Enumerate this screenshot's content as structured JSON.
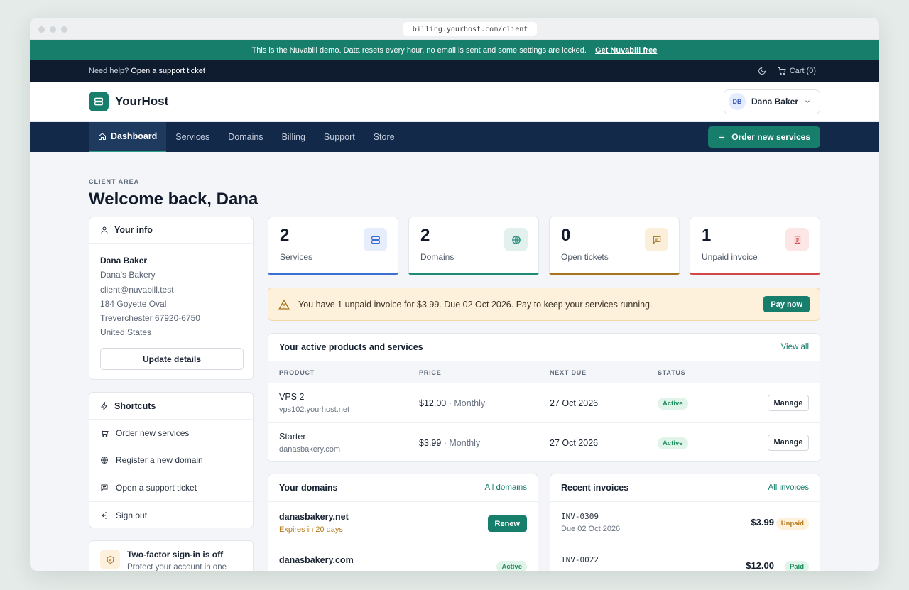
{
  "browser": {
    "url": "billing.yourhost.com/client"
  },
  "demo_banner": {
    "text": "This is the Nuvabill demo. Data resets every hour, no email is sent and some settings are locked.",
    "link": "Get Nuvabill free"
  },
  "topbar": {
    "help_prefix": "Need help?",
    "help_link": "Open a support ticket",
    "cart": "Cart (0)"
  },
  "header": {
    "brand": "YourHost",
    "user_initials": "DB",
    "user_name": "Dana Baker"
  },
  "nav": {
    "items": [
      {
        "label": "Dashboard",
        "active": true
      },
      {
        "label": "Services"
      },
      {
        "label": "Domains"
      },
      {
        "label": "Billing"
      },
      {
        "label": "Support"
      },
      {
        "label": "Store"
      }
    ],
    "order_button": "Order new services"
  },
  "page": {
    "eyebrow": "CLIENT AREA",
    "title": "Welcome back, Dana"
  },
  "your_info": {
    "title": "Your info",
    "name": "Dana Baker",
    "company": "Dana's Bakery",
    "email": "client@nuvabill.test",
    "address1": "184 Goyette Oval",
    "address2": "Treverchester 67920-6750",
    "country": "United States",
    "button": "Update details"
  },
  "shortcuts": {
    "title": "Shortcuts",
    "items": [
      "Order new services",
      "Register a new domain",
      "Open a support ticket",
      "Sign out"
    ]
  },
  "twofa": {
    "title": "Two-factor sign-in is off",
    "subtitle": "Protect your account in one"
  },
  "stats": [
    {
      "value": "2",
      "label": "Services",
      "color": "#3b6fd1",
      "bg": "#e6edfb"
    },
    {
      "value": "2",
      "label": "Domains",
      "color": "#1f8a76",
      "bg": "#e2f1ee"
    },
    {
      "value": "0",
      "label": "Open tickets",
      "color": "#a6741c",
      "bg": "#fbefd9"
    },
    {
      "value": "1",
      "label": "Unpaid invoice",
      "color": "#d24848",
      "bg": "#fde6e6"
    }
  ],
  "alert": {
    "text": "You have 1 unpaid invoice for $3.99. Due 02 Oct 2026. Pay to keep your services running.",
    "button": "Pay now"
  },
  "services": {
    "title": "Your active products and services",
    "link": "View all",
    "columns": [
      "PRODUCT",
      "PRICE",
      "NEXT DUE",
      "STATUS"
    ],
    "rows": [
      {
        "name": "VPS 2",
        "host": "vps102.yourhost.net",
        "price": "$12.00",
        "cycle": "· Monthly",
        "due": "27 Oct 2026",
        "status": "Active",
        "action": "Manage"
      },
      {
        "name": "Starter",
        "host": "danasbakery.com",
        "price": "$3.99",
        "cycle": "· Monthly",
        "due": "27 Oct 2026",
        "status": "Active",
        "action": "Manage"
      }
    ]
  },
  "domains": {
    "title": "Your domains",
    "link": "All domains",
    "rows": [
      {
        "name": "danasbakery.net",
        "sub": "Expires in 20 days",
        "action": "Renew"
      },
      {
        "name": "danasbakery.com",
        "sub": "",
        "status": "Active"
      }
    ]
  },
  "invoices": {
    "title": "Recent invoices",
    "link": "All invoices",
    "rows": [
      {
        "id": "INV-0309",
        "due": "Due 02 Oct 2026",
        "amount": "$3.99",
        "status": "Unpaid"
      },
      {
        "id": "INV-0022",
        "due": "",
        "amount": "$12.00",
        "status": "Paid"
      }
    ]
  }
}
